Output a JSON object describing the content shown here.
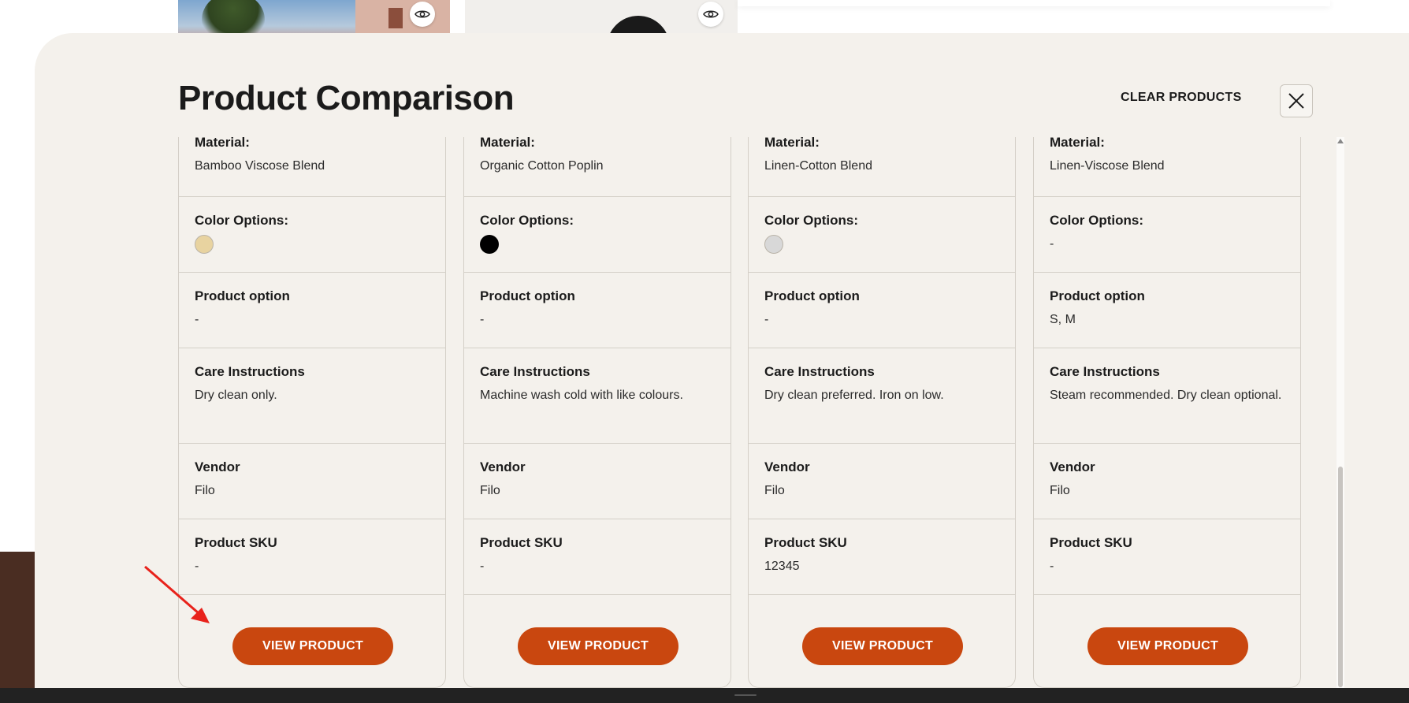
{
  "page": {
    "title": "Product Comparison",
    "clear_label": "CLEAR PRODUCTS",
    "close_icon": "close-icon",
    "eye_icon": "eye-icon"
  },
  "colors": {
    "accent": "#c9470f",
    "panel": "#f4f1ec",
    "border": "#d4cfc7",
    "annotation": "#e8221b"
  },
  "rows": {
    "material": "Material:",
    "color_options": "Color Options:",
    "product_option": "Product option",
    "care": "Care Instructions",
    "vendor": "Vendor",
    "sku": "Product SKU"
  },
  "products": [
    {
      "material": "Bamboo Viscose Blend",
      "color_swatch": "#e8d3a0",
      "color_text": "",
      "product_option": "-",
      "care": "Dry clean only.",
      "vendor": "Filo",
      "sku": "-",
      "button": "VIEW PRODUCT"
    },
    {
      "material": "Organic Cotton Poplin",
      "color_swatch": "#000000",
      "color_text": "",
      "product_option": "-",
      "care": "Machine wash cold with like colours.",
      "vendor": "Filo",
      "sku": "-",
      "button": "VIEW PRODUCT"
    },
    {
      "material": "Linen-Cotton Blend",
      "color_swatch": "#d8d8d8",
      "color_text": "",
      "product_option": "-",
      "care": "Dry clean preferred. Iron on low.",
      "vendor": "Filo",
      "sku": "12345",
      "button": "VIEW PRODUCT"
    },
    {
      "material": "Linen-Viscose Blend",
      "color_swatch": "",
      "color_text": "-",
      "product_option": "S, M",
      "care": "Steam recommended. Dry clean optional.",
      "vendor": "Filo",
      "sku": "-",
      "button": "VIEW PRODUCT"
    }
  ]
}
